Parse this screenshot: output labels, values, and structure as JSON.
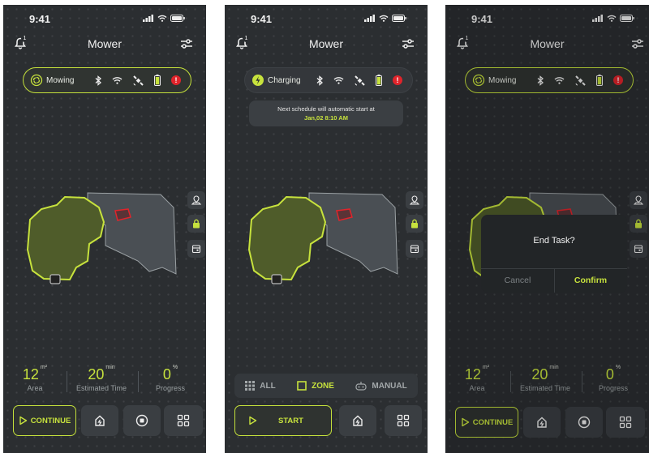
{
  "screens": [
    {
      "status_bar": {
        "time": "9:41"
      },
      "header": {
        "title": "Mower",
        "notification_count": "1"
      },
      "status_pill": {
        "state": "Mowing",
        "alert": "!"
      },
      "stats": [
        {
          "value": "12",
          "unit": "m²",
          "label": "Area"
        },
        {
          "value": "20",
          "unit": "min",
          "label": "Estimated Time"
        },
        {
          "value": "0",
          "unit": "%",
          "label": "Progress"
        }
      ],
      "controls": {
        "continue_label": "CONTINUE"
      }
    },
    {
      "status_bar": {
        "time": "9:41"
      },
      "header": {
        "title": "Mower",
        "notification_count": "1"
      },
      "status_pill": {
        "state": "Charging",
        "alert": "!"
      },
      "notice": {
        "line1": "Next schedule will automatic start at",
        "line2": "Jan,02  8:10 AM"
      },
      "mode_tabs": [
        {
          "label": "ALL",
          "active": false
        },
        {
          "label": "ZONE",
          "active": true
        },
        {
          "label": "MANUAL",
          "active": false
        }
      ],
      "controls": {
        "start_label": "START"
      }
    },
    {
      "status_bar": {
        "time": "9:41"
      },
      "header": {
        "title": "Mower",
        "notification_count": "1"
      },
      "status_pill": {
        "state": "Mowing",
        "alert": "!"
      },
      "stats": [
        {
          "value": "12",
          "unit": "m²",
          "label": "Area"
        },
        {
          "value": "20",
          "unit": "min",
          "label": "Estimated Time"
        },
        {
          "value": "0",
          "unit": "%",
          "label": "Progress"
        }
      ],
      "controls": {
        "continue_label": "CONTINUE"
      },
      "dialog": {
        "title": "End Task?",
        "cancel_label": "Cancel",
        "confirm_label": "Confirm"
      }
    }
  ],
  "colors": {
    "accent": "#c7e23d",
    "background": "#2b2e31",
    "alert": "#e0242b"
  },
  "icons": [
    "bell-icon",
    "filter-icon",
    "mowing-icon",
    "charging-icon",
    "bluetooth-icon",
    "wifi-icon",
    "satellite-icon",
    "battery-icon",
    "alert-icon",
    "map-pin-icon",
    "lock-icon",
    "calendar-icon",
    "play-icon",
    "home-icon",
    "stop-icon",
    "grid-icon"
  ]
}
